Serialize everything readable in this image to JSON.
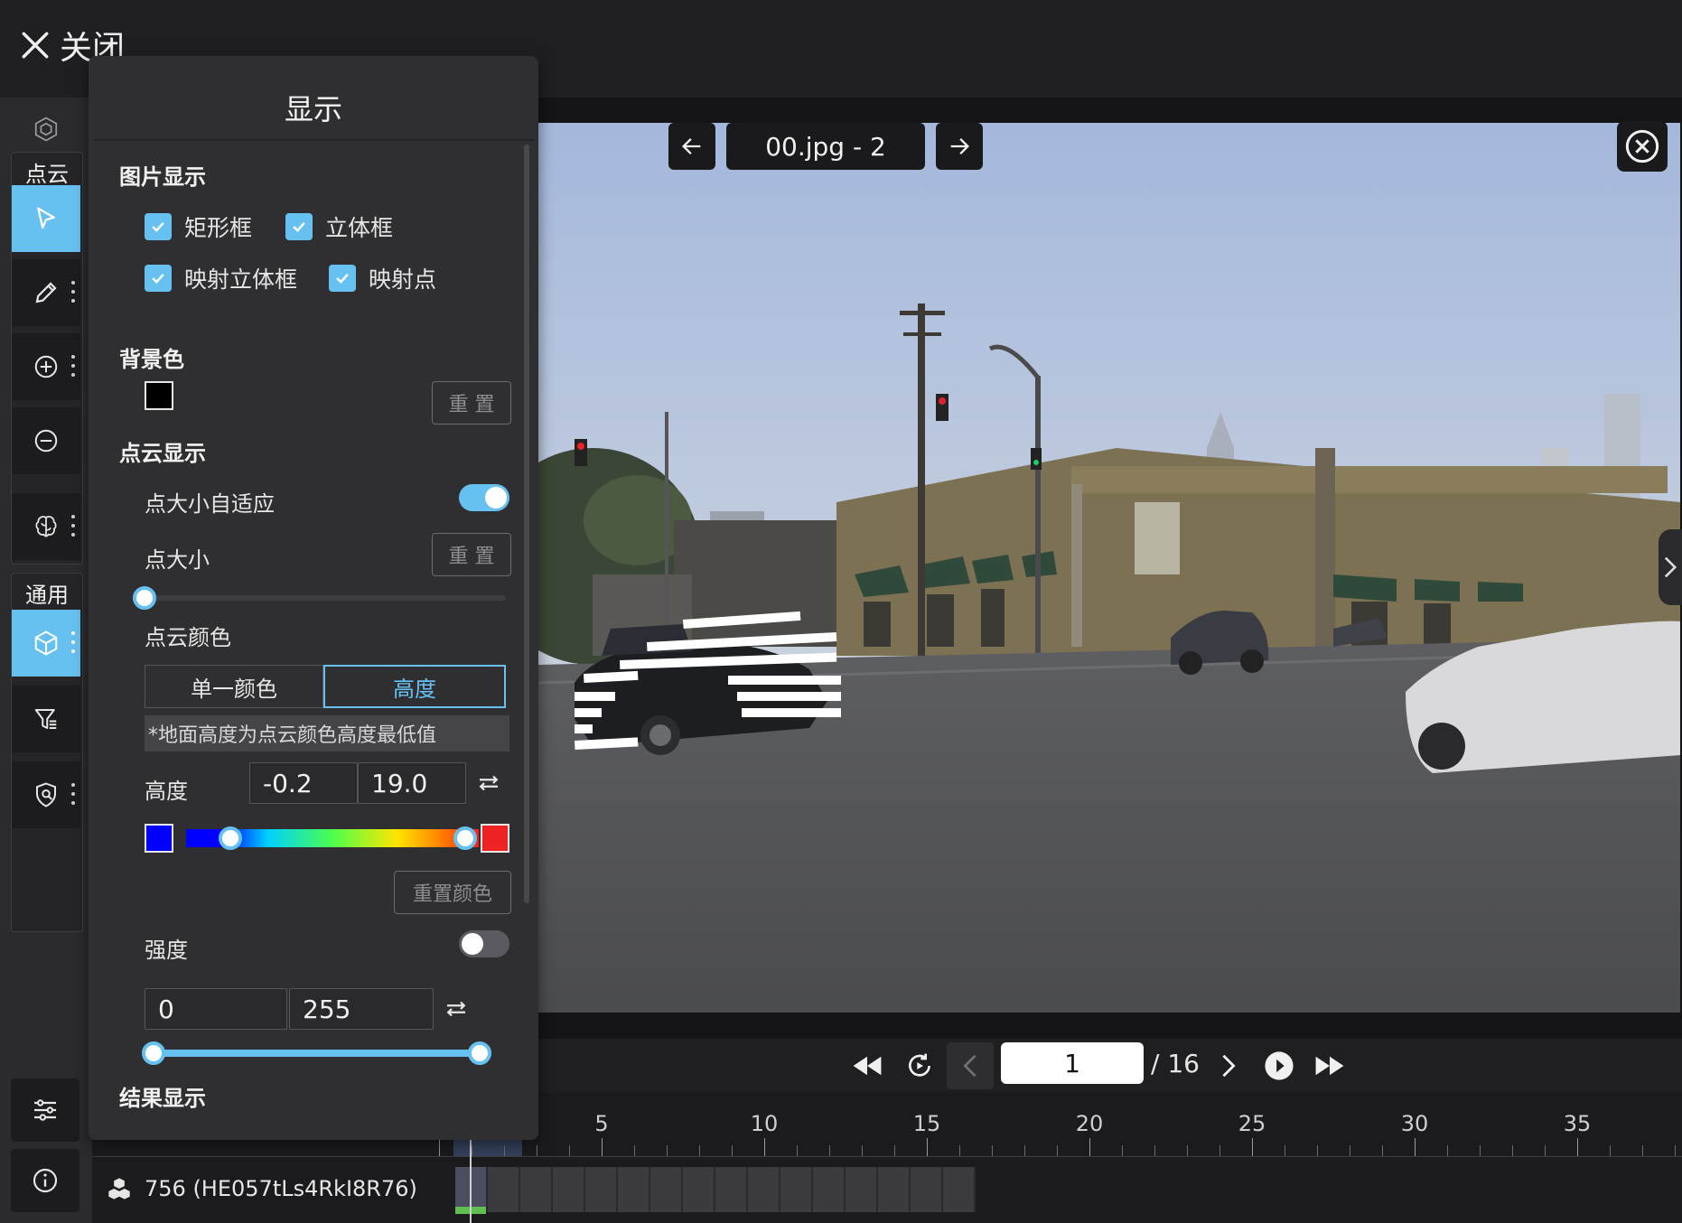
{
  "header": {
    "close_label": "关闭"
  },
  "toolbar": {
    "pointcloud_group_label": "点云",
    "general_group_label": "通用",
    "tools": [
      "select-tool",
      "pencil-tool",
      "add-point-tool",
      "remove-point-tool",
      "ai-tool",
      "cube-tool",
      "filter-tool",
      "search-shield-tool"
    ]
  },
  "panel": {
    "title": "显示",
    "image_display": {
      "title": "图片显示",
      "options": [
        {
          "label": "矩形框",
          "checked": true
        },
        {
          "label": "立体框",
          "checked": true
        },
        {
          "label": "映射立体框",
          "checked": true
        },
        {
          "label": "映射点",
          "checked": true
        }
      ]
    },
    "background": {
      "title": "背景色",
      "color": "#000000",
      "reset_label": "重 置"
    },
    "pointcloud_display": {
      "title": "点云显示",
      "auto_size_label": "点大小自适应",
      "auto_size_on": true,
      "point_size_label": "点大小",
      "point_size_reset_label": "重 置",
      "point_size_value": 0,
      "color_label": "点云颜色",
      "color_modes": [
        "单一颜色",
        "高度"
      ],
      "color_mode_selected": "高度",
      "note": "*地面高度为点云颜色高度最低值",
      "height_label": "高度",
      "height_min": "-0.2",
      "height_max": "19.0",
      "gradient_low_color": "#0000ff",
      "gradient_high_color": "#ee2222",
      "reset_color_label": "重置颜色",
      "intensity_label": "强度",
      "intensity_on": false,
      "intensity_min": "0",
      "intensity_max": "255"
    },
    "result_display": {
      "title": "结果显示"
    }
  },
  "viewer": {
    "image_name": "00.jpg - 2"
  },
  "playback": {
    "current_frame": "1",
    "total_label": "/ 16"
  },
  "timeline": {
    "tick_labels": [
      "5",
      "10",
      "15",
      "20",
      "25",
      "30",
      "35"
    ],
    "track_label": "756 (HE057tLs4RkI8R76)"
  },
  "colors": {
    "accent": "#66c1f0",
    "panel_bg": "#2f2f32",
    "toolbar_bg": "#2b2b2e"
  }
}
